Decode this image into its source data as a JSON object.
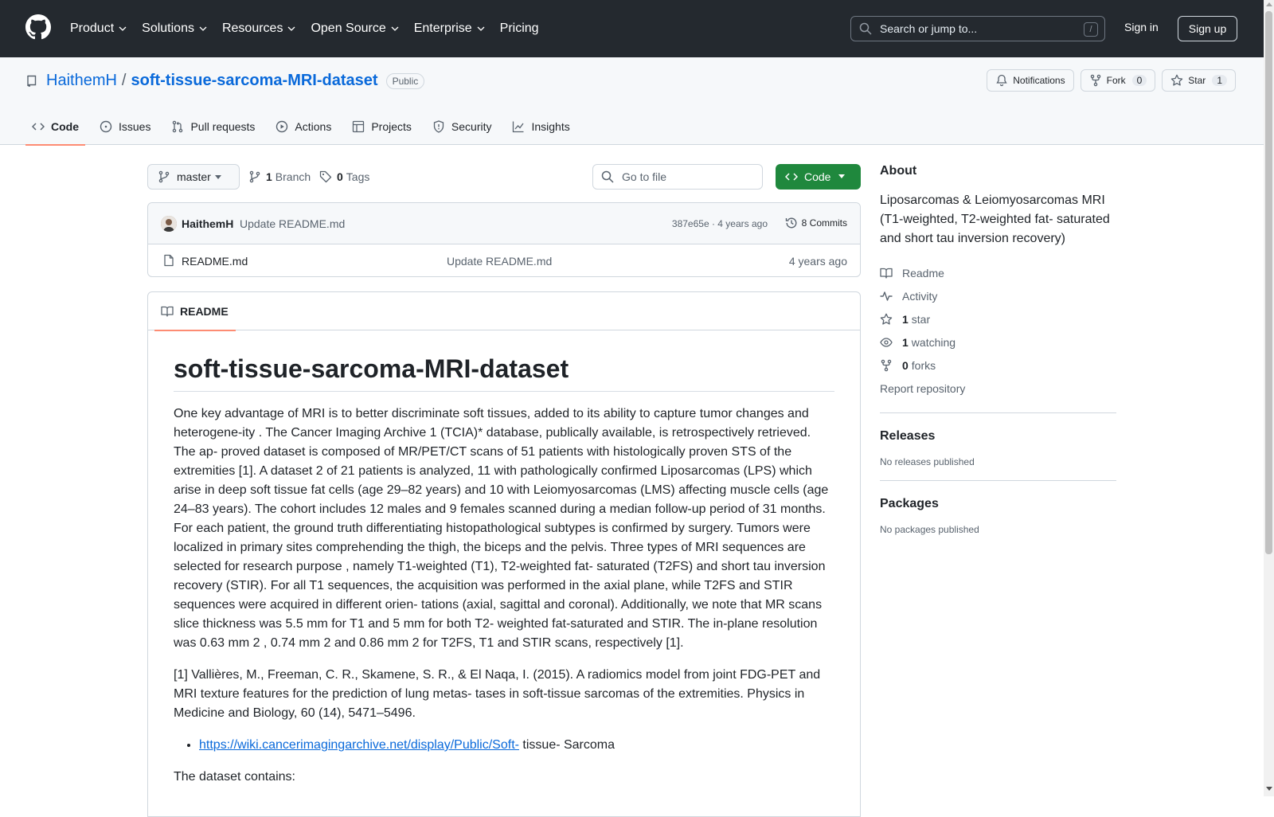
{
  "header": {
    "nav": [
      {
        "label": "Product",
        "has_menu": true
      },
      {
        "label": "Solutions",
        "has_menu": true
      },
      {
        "label": "Resources",
        "has_menu": true
      },
      {
        "label": "Open Source",
        "has_menu": true
      },
      {
        "label": "Enterprise",
        "has_menu": true
      },
      {
        "label": "Pricing",
        "has_menu": false
      }
    ],
    "search_placeholder": "Search or jump to...",
    "search_shortcut": "/",
    "sign_in": "Sign in",
    "sign_up": "Sign up"
  },
  "repo": {
    "owner": "HaithemH",
    "separator": "/",
    "name": "soft-tissue-sarcoma-MRI-dataset",
    "visibility": "Public",
    "notifications_label": "Notifications",
    "fork_label": "Fork",
    "fork_count": "0",
    "star_label": "Star",
    "star_count": "1",
    "tabs": [
      "Code",
      "Issues",
      "Pull requests",
      "Actions",
      "Projects",
      "Security",
      "Insights"
    ],
    "active_tab": "Code"
  },
  "toolbar": {
    "branch": "master",
    "branch_count": "1",
    "branch_label": "Branch",
    "tag_count": "0",
    "tag_label": "Tags",
    "goto_placeholder": "Go to file",
    "code_button": "Code"
  },
  "latest_commit": {
    "author": "HaithemH",
    "message": "Update README.md",
    "meta": "387e65e · 4 years ago",
    "commits": "8 Commits"
  },
  "files": [
    {
      "name": "README.md",
      "message": "Update README.md",
      "date": "4 years ago"
    }
  ],
  "readme": {
    "tab_label": "README",
    "title": "soft-tissue-sarcoma-MRI-dataset",
    "paragraph1": "One key advantage of MRI is to better discriminate soft tissues, added to its ability to capture tumor changes and heterogene-ity . The Cancer Imaging Archive 1 (TCIA)* database, publically available, is retrospectively retrieved. The ap- proved dataset is composed of MR/PET/CT scans of 51 patients with histologically proven STS of the extremities [1]. A dataset 2 of 21 patients is analyzed, 11 with pathologically confirmed Liposarcomas (LPS) which arise in deep soft tissue fat cells (age 29–82 years) and 10 with Leiomyosarcomas (LMS) affecting muscle cells (age 24–83 years). The cohort includes 12 males and 9 females scanned during a median follow-up period of 31 months. For each patient, the ground truth differentiating histopathological subtypes is confirmed by surgery. Tumors were localized in primary sites comprehending the thigh, the biceps and the pelvis. Three types of MRI sequences are selected for research purpose , namely T1-weighted (T1), T2-weighted fat- saturated (T2FS) and short tau inversion recovery (STIR). For all T1 sequences, the acquisition was performed in the axial plane, while T2FS and STIR sequences were acquired in different orien- tations (axial, sagittal and coronal). Additionally, we note that MR scans slice thickness was 5.5 mm for T1 and 5 mm for both T2- weighted fat-saturated and STIR. The in-plane resolution was 0.63 mm 2 , 0.74 mm 2 and 0.86 mm 2 for T2FS, T1 and STIR scans, respectively [1].",
    "paragraph2": "[1] Vallières, M., Freeman, C. R., Skamene, S. R., & El Naqa, I. (2015). A radiomics model from joint FDG-PET and MRI texture features for the prediction of lung metas- tases in soft-tissue sarcomas of the extremities. Physics in Medicine and Biology, 60 (14), 5471–5496.",
    "link_text": "https://wiki.cancerimagingarchive.net/display/Public/Soft-",
    "link_suffix": " tissue- Sarcoma",
    "paragraph3": "The dataset contains:"
  },
  "sidebar": {
    "about_title": "About",
    "description": "Liposarcomas & Leiomyosarcomas MRI (T1-weighted, T2-weighted fat- saturated and short tau inversion recovery)",
    "readme": "Readme",
    "activity": "Activity",
    "stars_count": "1",
    "stars_label": "star",
    "watching_count": "1",
    "watching_label": "watching",
    "forks_count": "0",
    "forks_label": "forks",
    "report": "Report repository",
    "releases_title": "Releases",
    "releases_empty": "No releases published",
    "packages_title": "Packages",
    "packages_empty": "No packages published"
  },
  "colors": {
    "header_bg": "#24292f",
    "link": "#0969da",
    "primary_button": "#1f883d",
    "tab_underline": "#fd8c73"
  }
}
